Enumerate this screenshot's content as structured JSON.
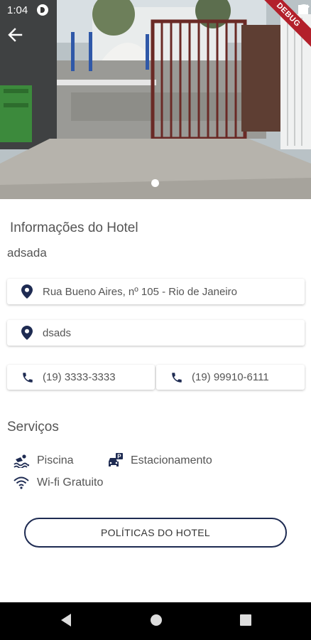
{
  "status_bar": {
    "time": "1:04"
  },
  "debug_banner": "DEBUG",
  "hotel": {
    "section_title": "Informações do Hotel",
    "name": "adsada",
    "address": "Rua Bueno Aires, nº 105 - Rio de Janeiro",
    "location": "dsads",
    "phone_1": "(19) 3333-3333",
    "phone_2": "(19) 99910-6111"
  },
  "services": {
    "title": "Serviços",
    "items": [
      {
        "label": "Piscina",
        "icon": "pool-icon"
      },
      {
        "label": "Estacionamento",
        "icon": "parking-icon"
      },
      {
        "label": "Wi-fi Gratuito",
        "icon": "wifi-icon"
      }
    ]
  },
  "policies_button": "POLÍTICAS DO HOTEL",
  "colors": {
    "accent": "#1e2b52",
    "icon": "#1e2b52"
  }
}
